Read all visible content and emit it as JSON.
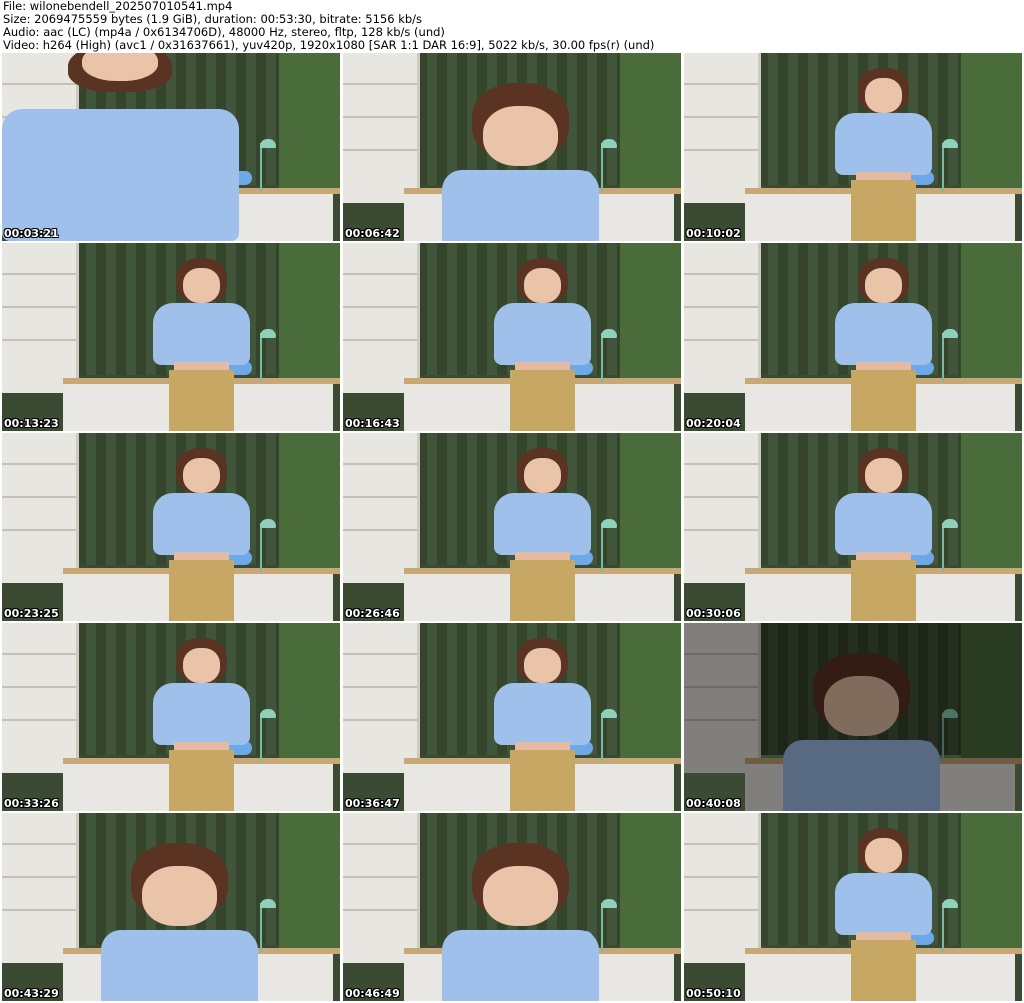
{
  "header": {
    "file": "File: wilonebendell_202507010541.mp4",
    "size": "Size: 2069475559 bytes (1.9 GiB), duration: 00:53:30, bitrate: 5156 kb/s",
    "audio": "Audio: aac (LC) (mp4a / 0x6134706D), 48000 Hz, stereo, fltp, 128 kb/s (und)",
    "video": "Video: h264 (High) (avc1 / 0x31637661), yuv420p, 1920x1080 [SAR 1:1 DAR 16:9], 5022 kb/s, 30.00 fps(r) (und)"
  },
  "thumbnails": [
    {
      "time": "00:03:21",
      "scene": "selfie"
    },
    {
      "time": "00:06:42",
      "scene": "closeup"
    },
    {
      "time": "00:10:02",
      "scene": "standing"
    },
    {
      "time": "00:13:23",
      "scene": "standing"
    },
    {
      "time": "00:16:43",
      "scene": "standing"
    },
    {
      "time": "00:20:04",
      "scene": "standing"
    },
    {
      "time": "00:23:25",
      "scene": "standing"
    },
    {
      "time": "00:26:46",
      "scene": "standing"
    },
    {
      "time": "00:30:06",
      "scene": "standing"
    },
    {
      "time": "00:33:26",
      "scene": "standing"
    },
    {
      "time": "00:36:47",
      "scene": "standing"
    },
    {
      "time": "00:40:08",
      "scene": "closeup-dark"
    },
    {
      "time": "00:43:29",
      "scene": "closeup"
    },
    {
      "time": "00:46:49",
      "scene": "closeup"
    },
    {
      "time": "00:50:10",
      "scene": "standing"
    }
  ]
}
